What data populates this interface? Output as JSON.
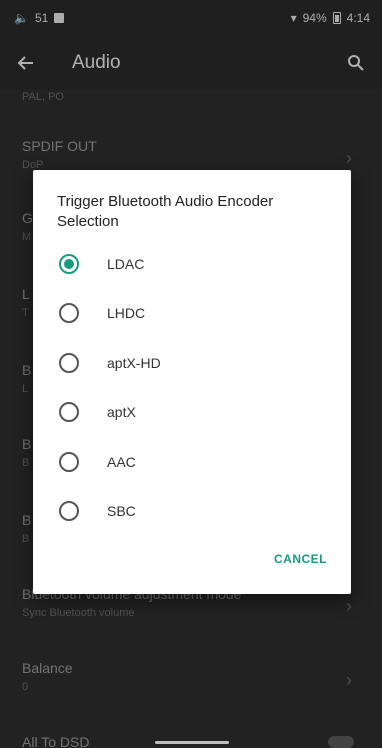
{
  "status_bar": {
    "notif_count": "51",
    "battery": "94%",
    "time": "4:14"
  },
  "app_bar": {
    "title": "Audio"
  },
  "background_settings": [
    {
      "title": "",
      "subtitle": "PAL, PO"
    },
    {
      "title": "SPDIF OUT",
      "subtitle": "DoP"
    },
    {
      "title": "G",
      "subtitle": "M"
    },
    {
      "title": "L",
      "subtitle": "T"
    },
    {
      "title": "B",
      "subtitle": "L"
    },
    {
      "title": "B",
      "subtitle": "B"
    },
    {
      "title": "B",
      "subtitle": "B"
    },
    {
      "title": "Bluetooth volume adjustment mode",
      "subtitle": "Sync Bluetooth volume"
    },
    {
      "title": "Balance",
      "subtitle": "0"
    },
    {
      "title": "All To DSD",
      "subtitle": ""
    }
  ],
  "dialog": {
    "title": "Trigger Bluetooth Audio Encoder Selection",
    "options": [
      {
        "label": "LDAC",
        "checked": true
      },
      {
        "label": "LHDC",
        "checked": false
      },
      {
        "label": "aptX-HD",
        "checked": false
      },
      {
        "label": "aptX",
        "checked": false
      },
      {
        "label": "AAC",
        "checked": false
      },
      {
        "label": "SBC",
        "checked": false
      }
    ],
    "cancel_label": "CANCEL"
  },
  "colors": {
    "accent": "#169b82",
    "dialog_bg": "#ffffff",
    "background": "#2e2e2e"
  }
}
